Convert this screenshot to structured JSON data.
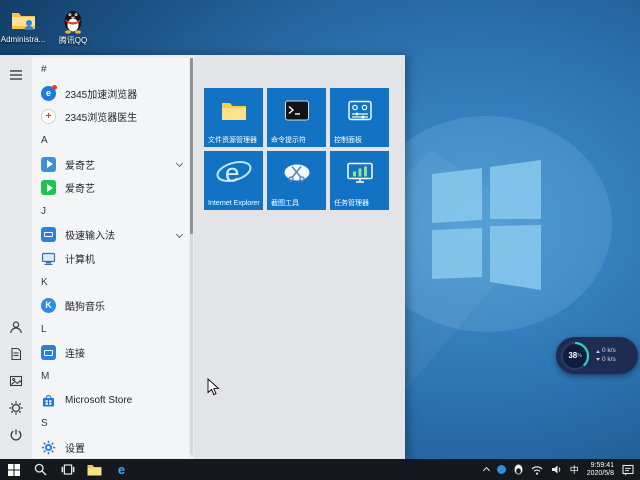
{
  "desktop": {
    "icons": [
      {
        "label": "Administra..."
      },
      {
        "label": "腾讯QQ"
      }
    ]
  },
  "start_menu": {
    "rows": [
      {
        "type": "header",
        "label": "#"
      },
      {
        "type": "app",
        "label": "2345加速浏览器"
      },
      {
        "type": "app",
        "label": "2345浏览器医生"
      },
      {
        "type": "header",
        "label": "A"
      },
      {
        "type": "app",
        "label": "爱奇艺",
        "expandable": true
      },
      {
        "type": "app",
        "label": "爱奇艺"
      },
      {
        "type": "header",
        "label": "J"
      },
      {
        "type": "app",
        "label": "极速输入法",
        "expandable": true
      },
      {
        "type": "app",
        "label": "计算机"
      },
      {
        "type": "header",
        "label": "K"
      },
      {
        "type": "app",
        "label": "酷狗音乐"
      },
      {
        "type": "header",
        "label": "L"
      },
      {
        "type": "app",
        "label": "连接"
      },
      {
        "type": "header",
        "label": "M"
      },
      {
        "type": "app",
        "label": "Microsoft Store"
      },
      {
        "type": "header",
        "label": "S"
      },
      {
        "type": "app",
        "label": "设置"
      }
    ],
    "tiles": [
      {
        "label": "文件资源管理器"
      },
      {
        "label": "命令提示符"
      },
      {
        "label": "控制面板"
      },
      {
        "label": "Internet Explorer"
      },
      {
        "label": "截图工具"
      },
      {
        "label": "任务管理器"
      }
    ]
  },
  "glyphs": {
    "ie": "e",
    "edge": "e",
    "kugou": "K",
    "browser_2345": "e",
    "doctor_cross": "+"
  },
  "net_widget": {
    "percent": "38",
    "percent_suffix": "%",
    "up_speed": "0 k/s",
    "down_speed": "0 k/s"
  },
  "taskbar": {
    "input_method": "中",
    "time": "9:59:41",
    "date": "2020/5/8"
  },
  "colors": {
    "tile_blue": "#1273c5",
    "accent_teal": "#2fd3c2",
    "taskbar_bg": "#15181c",
    "start_menu_bg": "#eaecee"
  }
}
